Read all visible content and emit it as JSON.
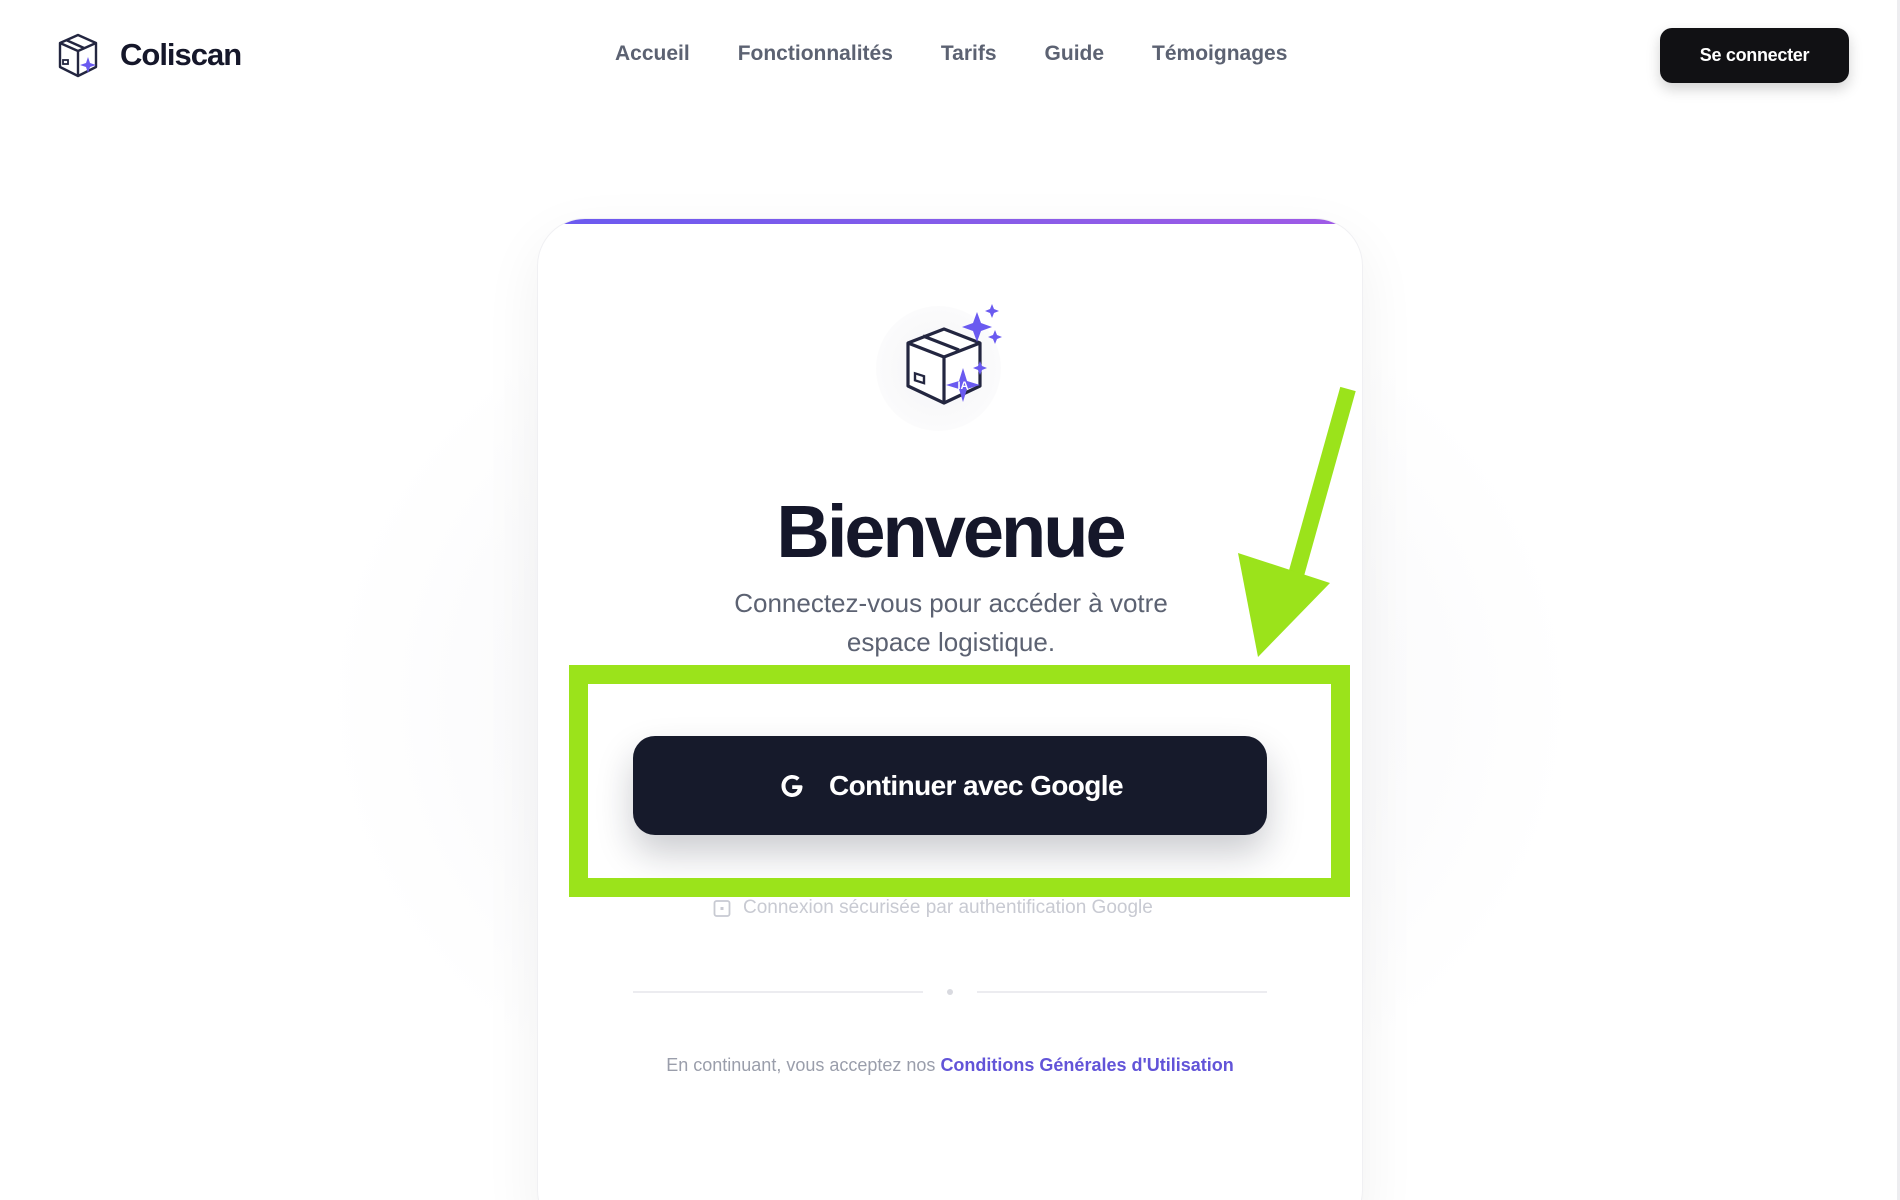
{
  "header": {
    "brand_name": "Coliscan",
    "nav": [
      {
        "label": "Accueil"
      },
      {
        "label": "Fonctionnalités"
      },
      {
        "label": "Tarifs"
      },
      {
        "label": "Guide"
      },
      {
        "label": "Témoignages"
      }
    ],
    "login_label": "Se connecter"
  },
  "card": {
    "icon_badge": "IA",
    "title": "Bienvenue",
    "subtitle": "Connectez-vous pour accéder à votre espace logistique.",
    "google_button_label": "Continuer avec Google",
    "secure_note": "Connexion sécurisée par authentification Google",
    "terms_prefix": "En continuant, vous acceptez nos",
    "terms_link": "Conditions Générales d'Utilisation"
  },
  "colors": {
    "accent_purple": "#6a5af0",
    "primary_dark": "#161a2b",
    "annotation_green": "#9be31b"
  },
  "icons": {
    "brand": "box-sparkle-icon",
    "hero": "box-sparkle-icon",
    "google": "google-g-icon",
    "secure": "lock-icon"
  }
}
